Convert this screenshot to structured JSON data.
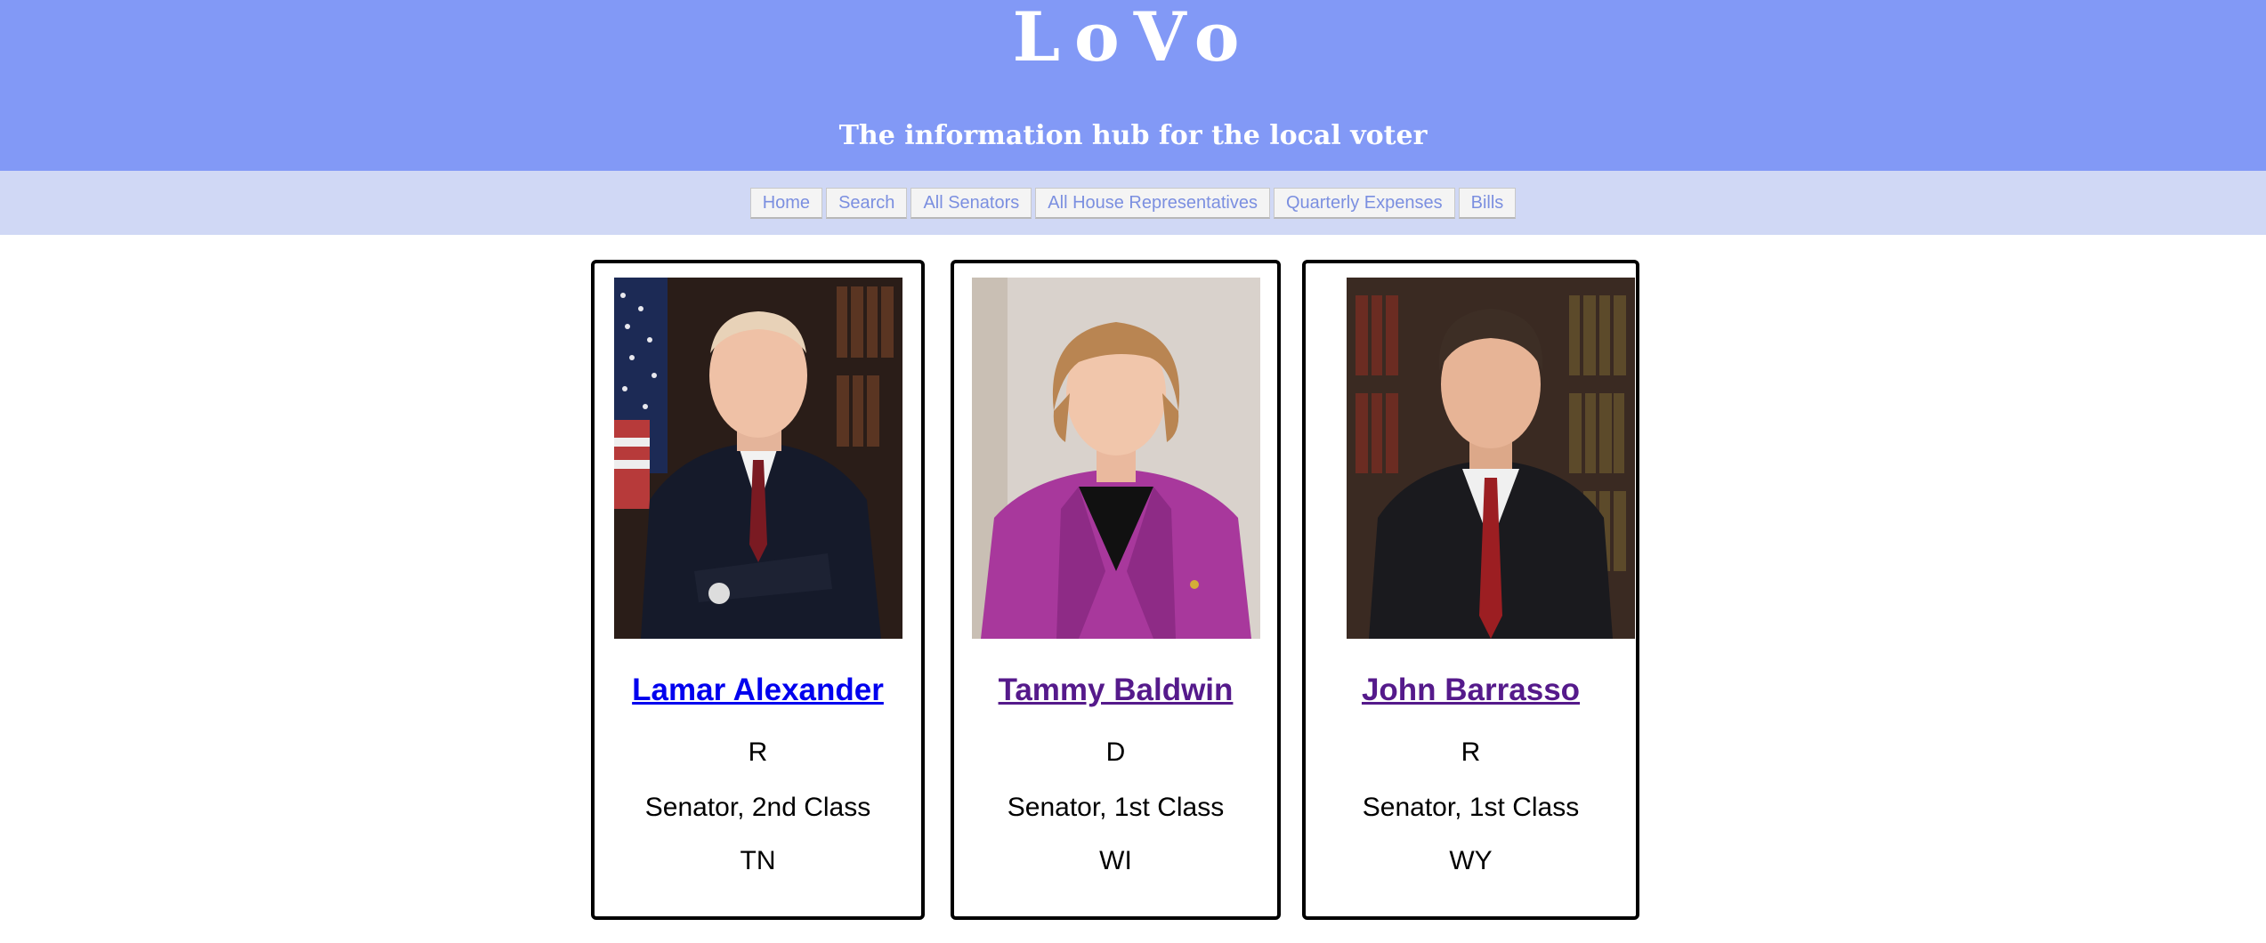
{
  "header": {
    "title": "LoVo",
    "tagline": "The information hub for the local voter",
    "background_color": "#8299f6"
  },
  "nav": {
    "background_color": "#d0d8f5",
    "items": [
      {
        "label": "Home"
      },
      {
        "label": "Search"
      },
      {
        "label": "All Senators"
      },
      {
        "label": "All House Representatives"
      },
      {
        "label": "Quarterly Expenses"
      },
      {
        "label": "Bills"
      }
    ]
  },
  "senators": [
    {
      "name": "Lamar Alexander",
      "party": "R",
      "title": "Senator, 2nd Class",
      "state": "TN",
      "link_color": "#0000ee",
      "photo": "portrait-photo"
    },
    {
      "name": "Tammy Baldwin",
      "party": "D",
      "title": "Senator, 1st Class",
      "state": "WI",
      "link_color": "#551a8b",
      "photo": "portrait-photo"
    },
    {
      "name": "John Barrasso",
      "party": "R",
      "title": "Senator, 1st Class",
      "state": "WY",
      "link_color": "#551a8b",
      "photo": "portrait-photo"
    }
  ]
}
